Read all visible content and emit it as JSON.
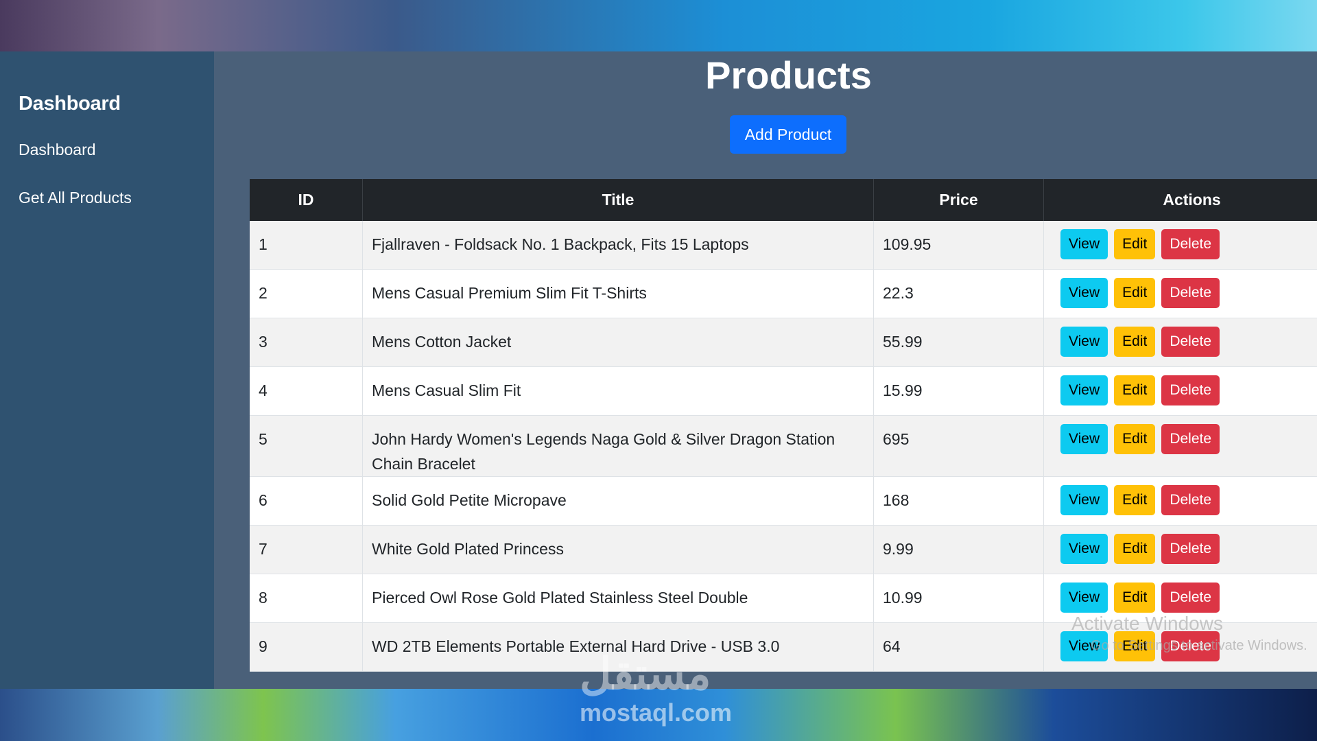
{
  "sidebar": {
    "brand": "Dashboard",
    "items": [
      {
        "label": "Dashboard"
      },
      {
        "label": "Get All Products"
      }
    ]
  },
  "main": {
    "title": "Products",
    "add_button": "Add Product"
  },
  "table": {
    "headers": [
      "ID",
      "Title",
      "Price",
      "Actions"
    ],
    "rows": [
      {
        "id": "1",
        "title": "Fjallraven - Foldsack No. 1 Backpack, Fits 15 Laptops",
        "price": "109.95"
      },
      {
        "id": "2",
        "title": "Mens Casual Premium Slim Fit T-Shirts",
        "price": "22.3"
      },
      {
        "id": "3",
        "title": "Mens Cotton Jacket",
        "price": "55.99"
      },
      {
        "id": "4",
        "title": "Mens Casual Slim Fit",
        "price": "15.99"
      },
      {
        "id": "5",
        "title": "John Hardy Women's Legends Naga Gold & Silver Dragon Station Chain Bracelet",
        "price": "695"
      },
      {
        "id": "6",
        "title": "Solid Gold Petite Micropave",
        "price": "168"
      },
      {
        "id": "7",
        "title": "White Gold Plated Princess",
        "price": "9.99"
      },
      {
        "id": "8",
        "title": "Pierced Owl Rose Gold Plated Stainless Steel Double",
        "price": "10.99"
      },
      {
        "id": "9",
        "title": "WD 2TB Elements Portable External Hard Drive - USB 3.0",
        "price": "64"
      }
    ],
    "actions": {
      "view": "View",
      "edit": "Edit",
      "delete": "Delete"
    }
  },
  "overlays": {
    "windows_activation": "Activate Windows",
    "windows_activation_sub": "Go to Settings to activate Windows.",
    "site_watermark": "mostaql.com",
    "site_logo": "مستقل"
  },
  "colors": {
    "sidebar": "#2f5270",
    "main": "#4a6079",
    "primary": "#0d6efd",
    "view": "#0dcaf0",
    "edit": "#ffc107",
    "delete": "#dc3545",
    "table_header": "#212529"
  }
}
